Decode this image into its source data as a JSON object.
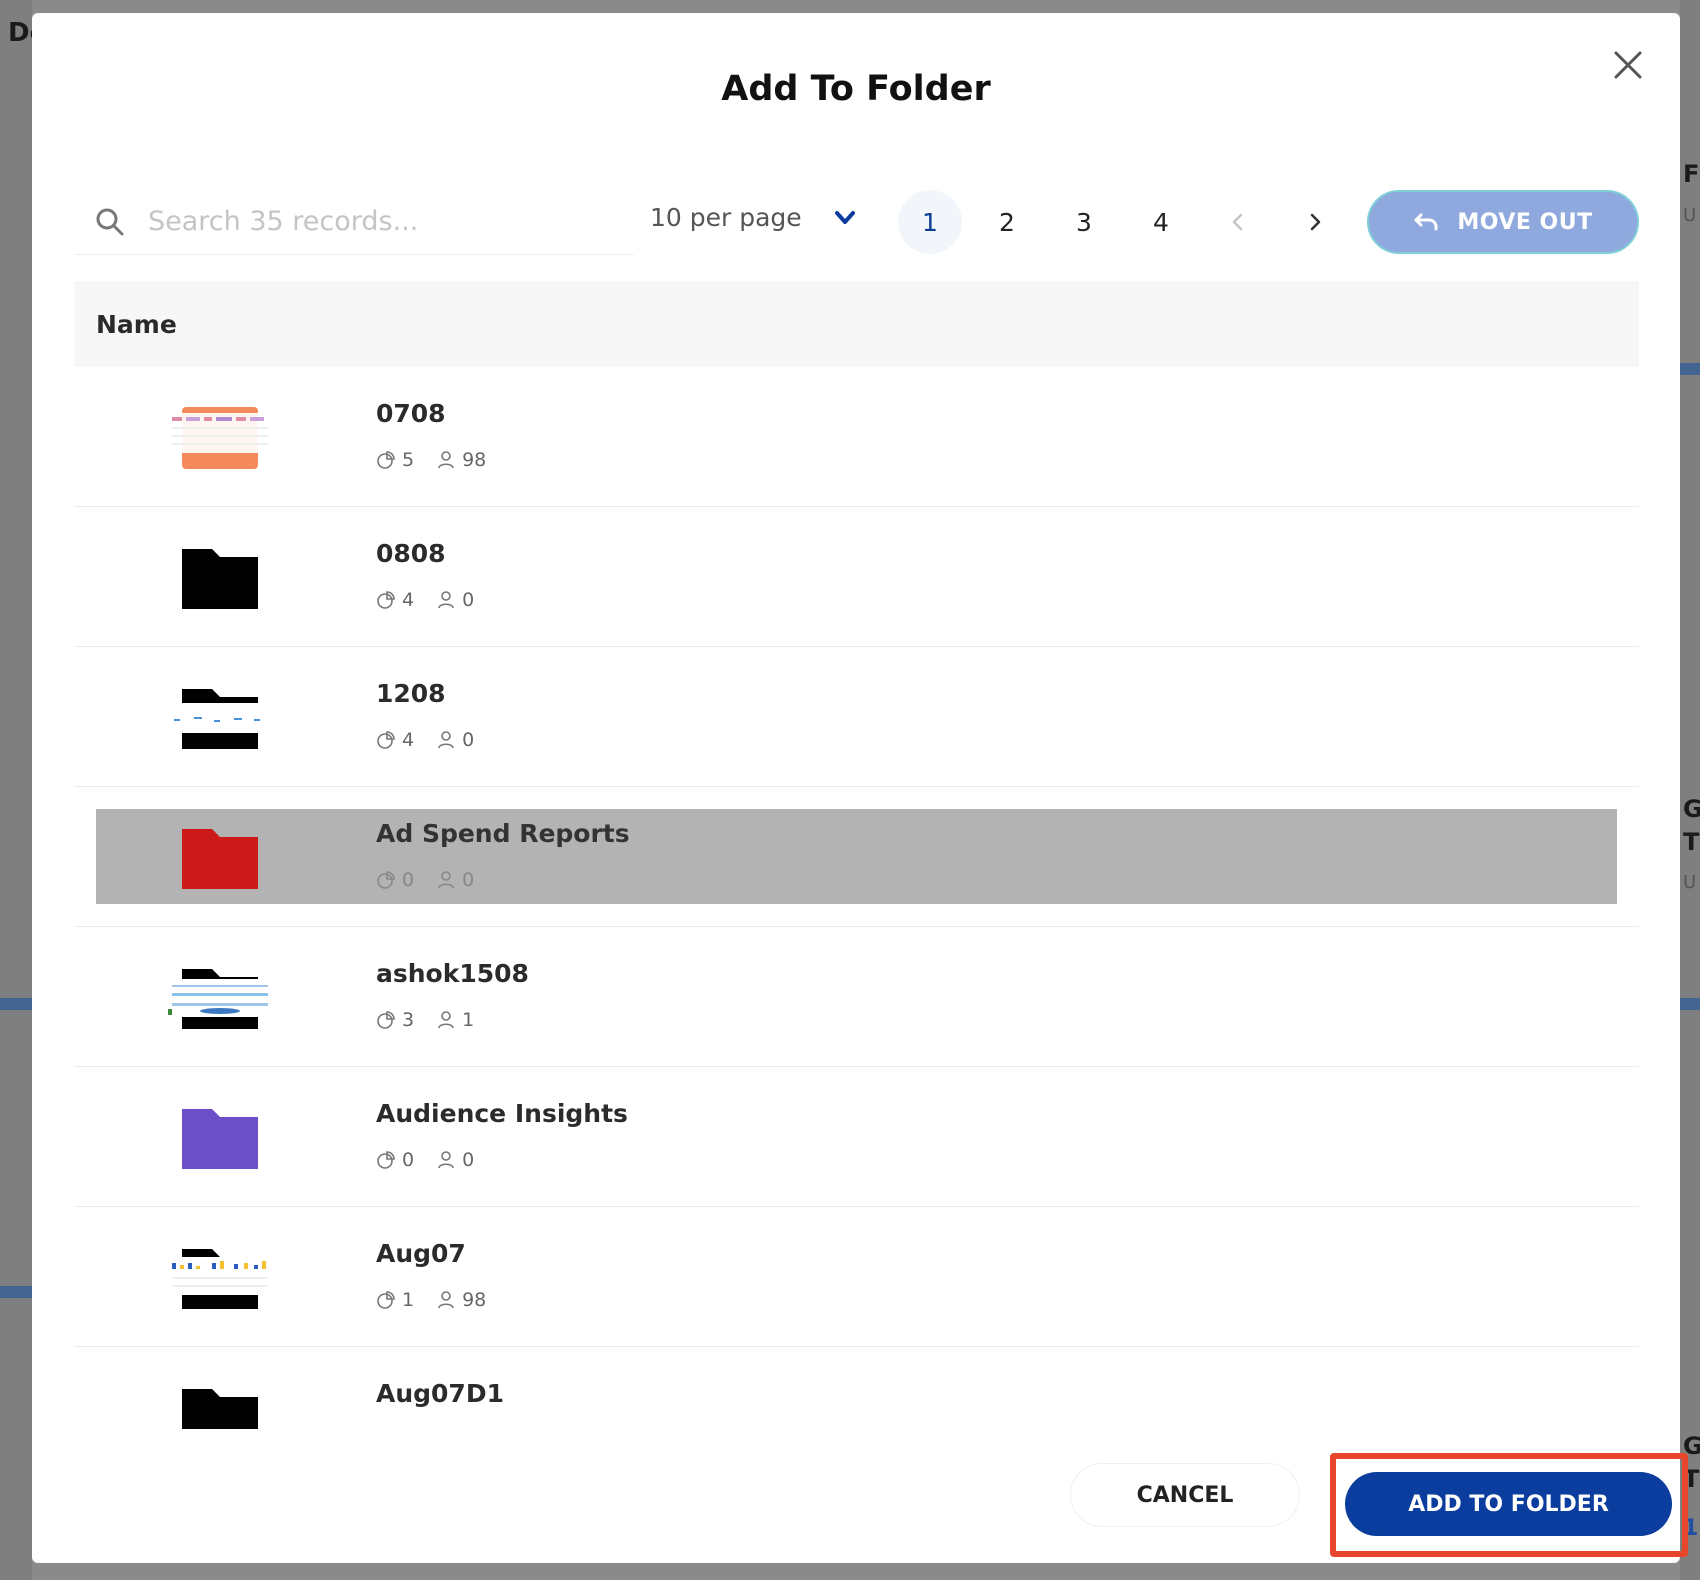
{
  "background": {
    "letters": [
      "De",
      "F",
      "U",
      "G",
      "T",
      "U",
      "G",
      "T",
      "1"
    ]
  },
  "modal": {
    "title": "Add To Folder",
    "close_icon": "close-icon"
  },
  "toolbar": {
    "search_placeholder": "Search 35 records...",
    "per_page_label": "10 per page",
    "pages": [
      "1",
      "2",
      "3",
      "4"
    ],
    "active_page": "1",
    "move_out_label": "MOVE OUT"
  },
  "table": {
    "column_header": "Name",
    "rows": [
      {
        "name": "0708",
        "charts": "5",
        "users": "98",
        "thumb": "orange-dashboard"
      },
      {
        "name": "0808",
        "charts": "4",
        "users": "0",
        "thumb": "black-folder"
      },
      {
        "name": "1208",
        "charts": "4",
        "users": "0",
        "thumb": "black-dashboard"
      },
      {
        "name": "Ad Spend Reports",
        "charts": "0",
        "users": "0",
        "thumb": "red-folder",
        "selected": true
      },
      {
        "name": "ashok1508",
        "charts": "3",
        "users": "1",
        "thumb": "blue-dashboard"
      },
      {
        "name": "Audience Insights",
        "charts": "0",
        "users": "0",
        "thumb": "purple-folder"
      },
      {
        "name": "Aug07",
        "charts": "1",
        "users": "98",
        "thumb": "yellow-dashboard"
      },
      {
        "name": "Aug07D1",
        "charts": "",
        "users": "",
        "thumb": "black-folder"
      }
    ]
  },
  "footer": {
    "cancel_label": "CANCEL",
    "add_label": "ADD TO FOLDER"
  },
  "colors": {
    "primary": "#0b3d9e",
    "move_out_bg": "#8fa8dd",
    "highlight": "#e8462a",
    "selected_row": "#b3b3b3",
    "folder_red": "#cc1a1a",
    "folder_purple": "#6b4fc9",
    "folder_orange": "#f4895a"
  }
}
